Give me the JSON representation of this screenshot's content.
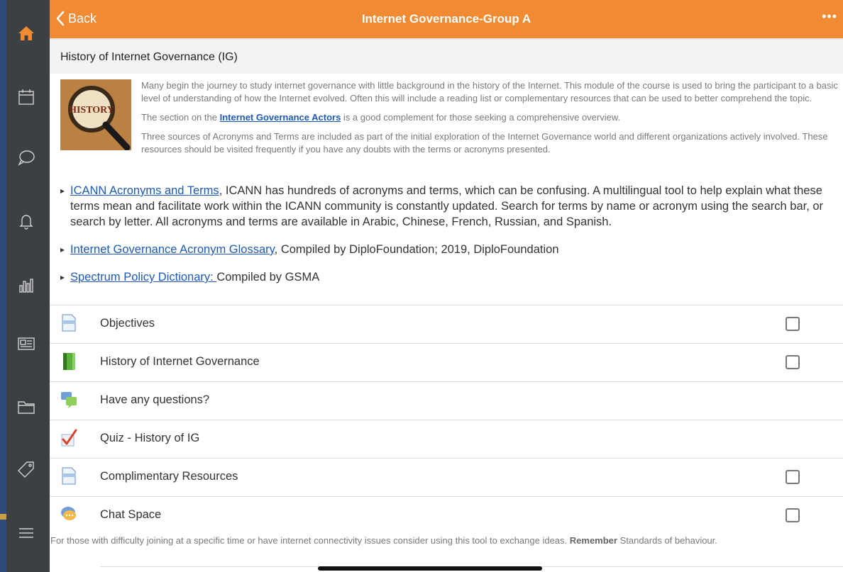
{
  "sidebar": {
    "items": [
      {
        "icon": "home-icon"
      },
      {
        "icon": "calendar-icon"
      },
      {
        "icon": "chat-bubble-icon"
      },
      {
        "icon": "bell-icon"
      },
      {
        "icon": "bar-chart-icon"
      },
      {
        "icon": "newspaper-icon"
      },
      {
        "icon": "folder-icon"
      },
      {
        "icon": "tag-icon"
      },
      {
        "icon": "menu-icon"
      }
    ],
    "accent_color": "#f08a33"
  },
  "header": {
    "back_label": "Back",
    "title": "Internet Governance-Group A",
    "more_label": "•••"
  },
  "section": {
    "title": "History of Internet Governance (IG)"
  },
  "intro": {
    "thumbnail_text": "HISTORY",
    "para1": "Many begin the journey to study internet governance with little background in the history of the Internet. This module of the course is used to bring the participant to a basic level of understanding of how the Internet evolved.  Often this will include a reading list or complementary resources that can be used to better comprehend the topic.",
    "para2_before": "The section on the ",
    "para2_link": "Internet Governance Actors",
    "para2_after": " is a good complement for those seeking a comprehensive overview.",
    "para3": "Three sources of Acronyms and Terms are included as part of the initial exploration of the Internet Governance world and different organizations actively involved. These resources should be visited frequently if you have any doubts with the terms or acronyms presented."
  },
  "bullets": [
    {
      "link": "ICANN Acronyms and Terms",
      "text": ", ICANN has hundreds of acronyms and terms, which can be confusing. A multilingual tool to help explain what these terms mean and facilitate work within the ICANN community is constantly updated. Search for terms by name or acronym using the search bar, or search by letter. All acronyms and terms are available in Arabic, Chinese, French, Russian, and Spanish."
    },
    {
      "link": "Internet Governance Acronym Glossary",
      "text": ", Compiled by DiploFoundation; 2019, DiploFoundation"
    },
    {
      "link": "Spectrum Policy Dictionary: ",
      "text": "Compiled by GSMA"
    }
  ],
  "activities": [
    {
      "label": "Objectives",
      "icon": "page-icon",
      "has_checkbox": true
    },
    {
      "label": "History of Internet Governance",
      "icon": "book-icon",
      "has_checkbox": true
    },
    {
      "label": "Have any questions?",
      "icon": "forum-icon",
      "has_checkbox": false
    },
    {
      "label": "Quiz - History of IG",
      "icon": "quiz-check-icon",
      "has_checkbox": false
    },
    {
      "label": "Complimentary Resources",
      "icon": "page-icon",
      "has_checkbox": true
    },
    {
      "label": "Chat Space",
      "icon": "chat-icon",
      "has_checkbox": true
    }
  ],
  "chat_description": {
    "before": "For those with difficulty joining at a specific time or have internet connectivity issues consider using this tool to exchange ideas. ",
    "bold": "Remember",
    "after": " Standards of behaviour."
  }
}
